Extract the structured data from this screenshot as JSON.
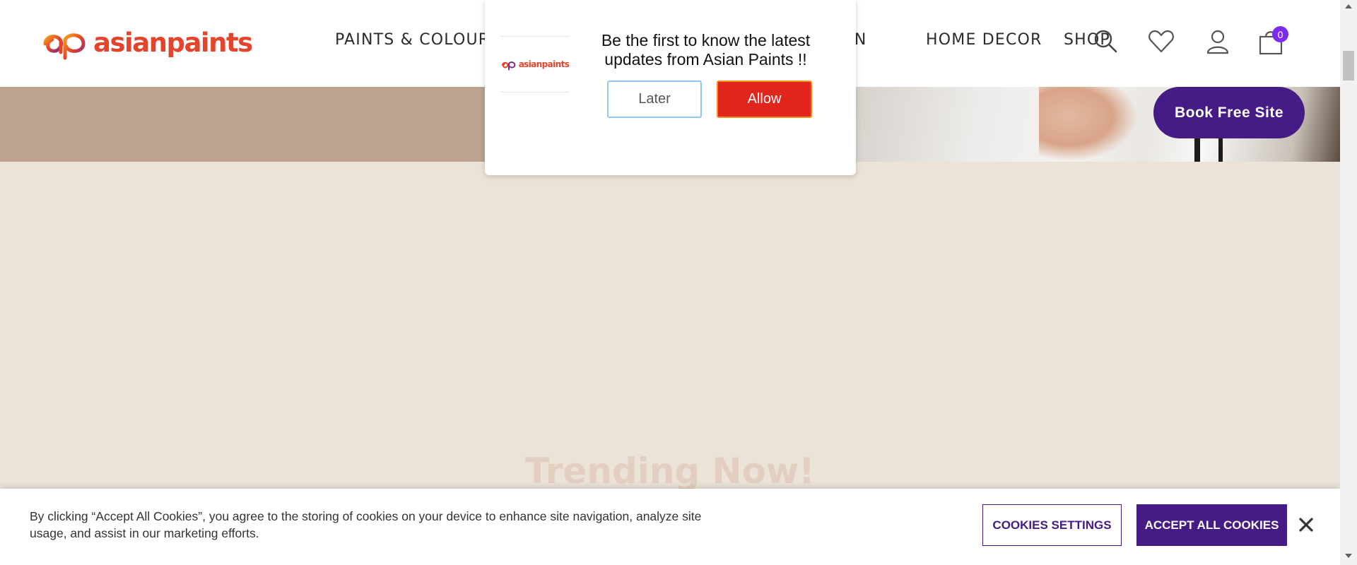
{
  "header": {
    "logo_text": "asianpaints",
    "nav": [
      {
        "label": "PAINTS & COLOURS"
      },
      {
        "label": "TION"
      },
      {
        "label": "HOME DECOR"
      },
      {
        "label": "SHOP"
      }
    ],
    "icons": [
      "search-icon",
      "wishlist-heart-icon",
      "user-icon",
      "cart-bag-icon"
    ],
    "cart_count": "0"
  },
  "hero": {
    "book_button": "Book Free Site"
  },
  "push_prompt": {
    "logo_text": "asianpaints",
    "message": "Be the first to know the latest updates from Asian Paints !!",
    "later_label": "Later",
    "allow_label": "Allow"
  },
  "trending": {
    "title": "Trending Now!"
  },
  "cookie_banner": {
    "text": "By clicking “Accept All Cookies”, you agree to the storing of cookies on your device to enhance site navigation, analyze site usage, and assist in our marketing efforts.",
    "settings_label": "COOKIES SETTINGS",
    "accept_label": "ACCEPT ALL COOKIES",
    "close_icon": "close-icon"
  },
  "colors": {
    "brand_purple": "#451b86",
    "brand_red": "#e5432a",
    "allow_red": "#e0251c",
    "badge_purple": "#7b2cf0",
    "page_beige": "#ebe3d7",
    "hero_tan": "#bda28f"
  }
}
